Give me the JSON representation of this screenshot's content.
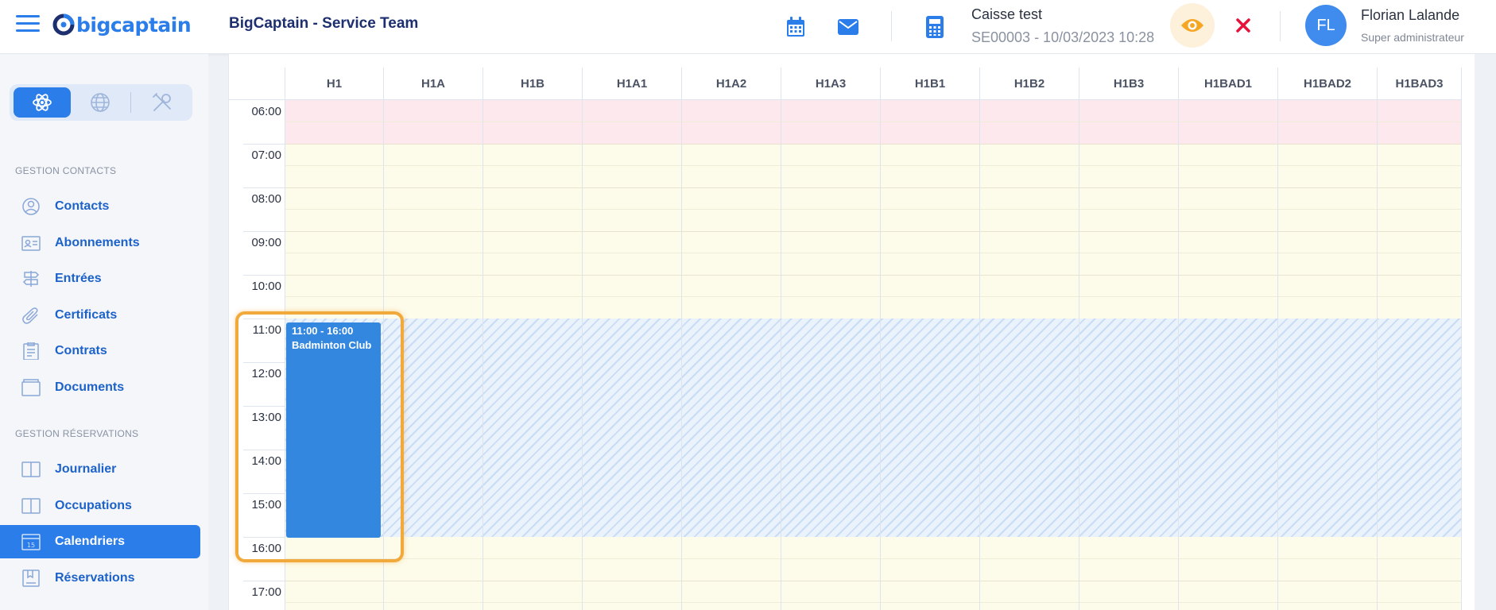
{
  "header": {
    "logo_text": "bigcaptain",
    "team_title": "BigCaptain - Service Team",
    "caisse_name": "Caisse test",
    "caisse_session": "SE00003 - 10/03/2023 10:28",
    "user_initials": "FL",
    "user_name": "Florian Lalande",
    "user_role": "Super administrateur",
    "icons": [
      "calendar-icon",
      "mail-icon",
      "calculator-icon",
      "eye-icon",
      "close-icon"
    ]
  },
  "sidebar": {
    "switcher": [
      "atom-icon",
      "globe-icon",
      "tools-icon"
    ],
    "section_contacts": "GESTION CONTACTS",
    "contacts_items": [
      {
        "label": "Contacts",
        "icon": "user-circle-icon"
      },
      {
        "label": "Abonnements",
        "icon": "id-card-icon"
      },
      {
        "label": "Entrées",
        "icon": "signpost-icon"
      },
      {
        "label": "Certificats",
        "icon": "paperclip-icon"
      },
      {
        "label": "Contrats",
        "icon": "clipboard-icon"
      },
      {
        "label": "Documents",
        "icon": "folder-icon"
      }
    ],
    "section_reservations": "GESTION RÉSERVATIONS",
    "reservation_items": [
      {
        "label": "Journalier",
        "icon": "book-open-icon"
      },
      {
        "label": "Occupations",
        "icon": "book-open-icon"
      },
      {
        "label": "Calendriers",
        "icon": "calendar-icon",
        "active": true
      },
      {
        "label": "Réservations",
        "icon": "bookmark-icon"
      }
    ]
  },
  "calendar": {
    "columns": [
      "H1",
      "H1A",
      "H1B",
      "H1A1",
      "H1A2",
      "H1A3",
      "H1B1",
      "H1B2",
      "H1B3",
      "H1BAD1",
      "H1BAD2",
      "H1BAD3"
    ],
    "times": [
      "06:00",
      "07:00",
      "08:00",
      "09:00",
      "10:00",
      "11:00",
      "12:00",
      "13:00",
      "14:00",
      "15:00",
      "16:00",
      "17:00"
    ],
    "event": {
      "time_range": "11:00 - 16:00",
      "title": "Badminton Club",
      "column": "H1"
    },
    "colors": {
      "closed": "#fde8ee",
      "open": "#fdfbe9",
      "event": "#3487de",
      "highlight": "#f2a93b"
    }
  }
}
